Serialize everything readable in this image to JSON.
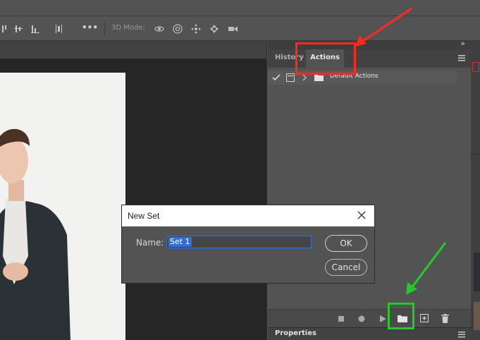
{
  "options_bar": {
    "mode_label": "3D Mode:",
    "icons": [
      "align-top-icon",
      "align-vcenter-icon",
      "align-bottom-icon",
      "distribute-icon",
      "more-icon",
      "orbit-3d-icon",
      "roll-3d-icon",
      "pan-3d-icon",
      "slide-3d-icon",
      "scale-3d-icon"
    ],
    "more_label": "•••"
  },
  "panel": {
    "collapse_label": "»",
    "tabs": [
      {
        "label": "History"
      },
      {
        "label": "Actions"
      }
    ],
    "menu_icon": "hamburger-icon",
    "actions_row_label": "Default Actions",
    "footer_icons": [
      "stop-icon",
      "record-icon",
      "play-icon",
      "new-set-folder-icon",
      "new-action-icon",
      "trash-icon"
    ],
    "properties_label": "Properties"
  },
  "dialog": {
    "title": "New Set",
    "name_label": "Name:",
    "name_value": "Set 1",
    "ok_label": "OK",
    "cancel_label": "Cancel"
  },
  "colors": {
    "annotation_red": "#ff2a1f",
    "annotation_green": "#24c92a",
    "selection_blue": "#2f6fd6"
  }
}
